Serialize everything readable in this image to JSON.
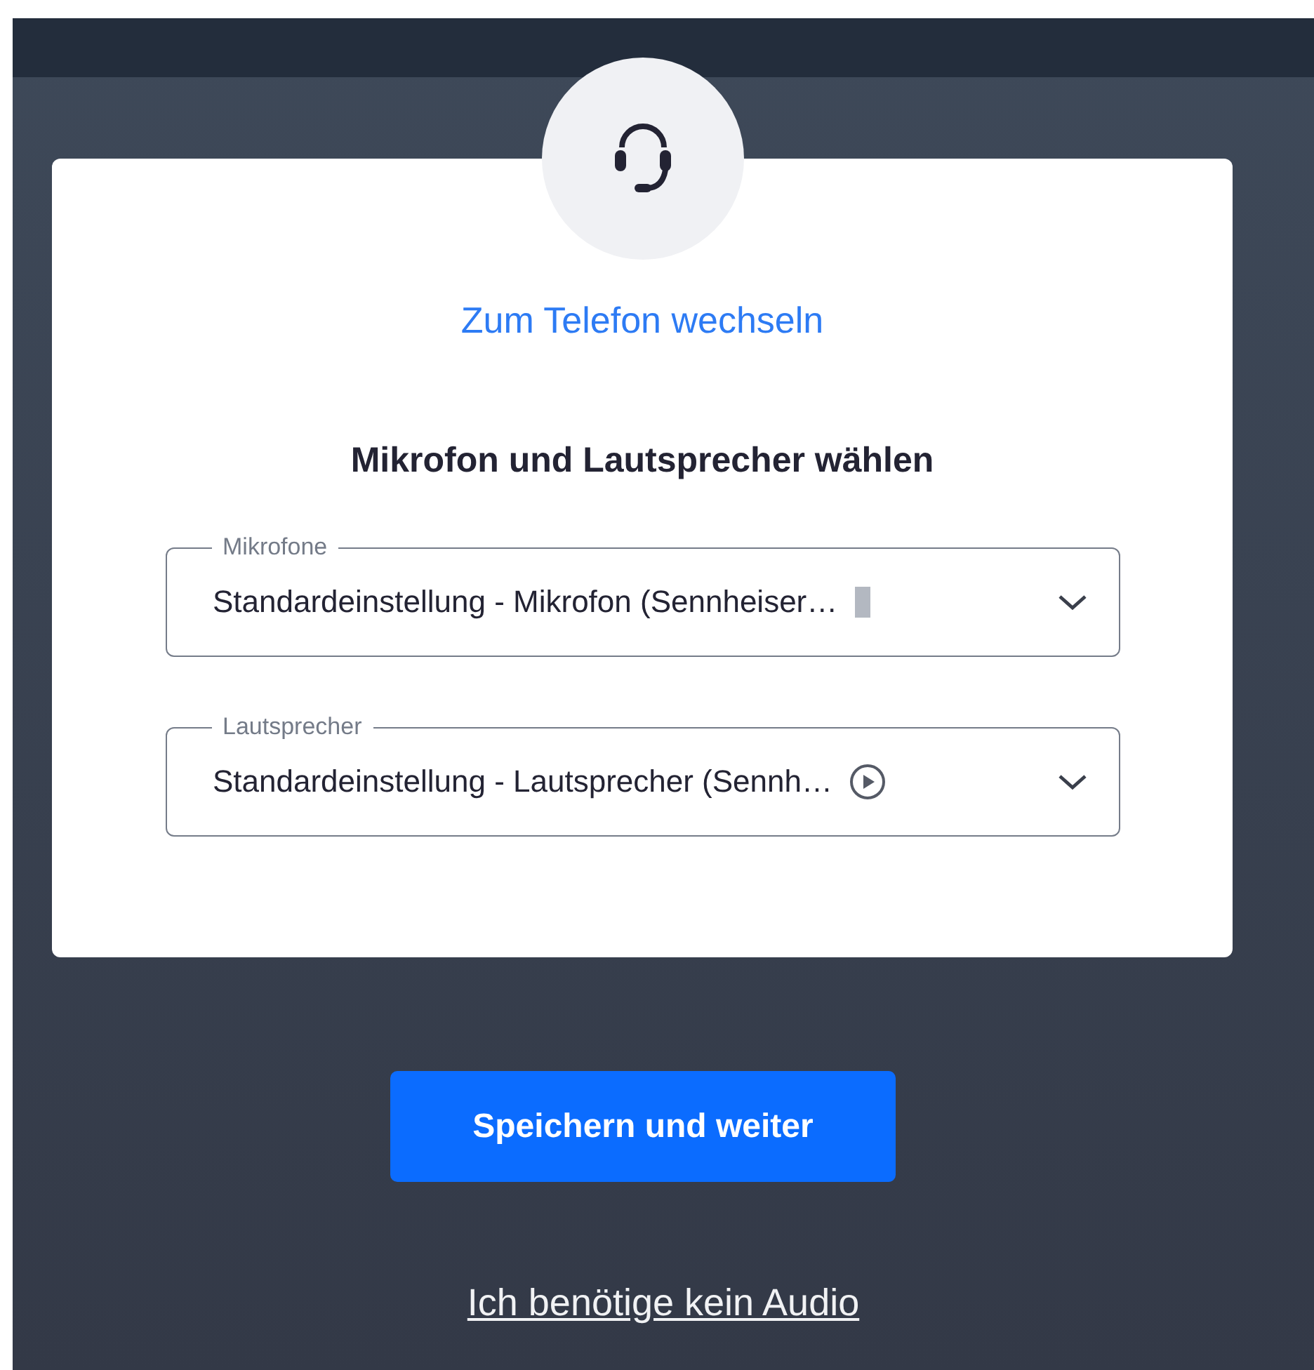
{
  "switch_link": "Zum Telefon wechseln",
  "heading": "Mikrofon und Lautsprecher wählen",
  "fields": [
    {
      "kind": "microphone",
      "label": "Mikrofone",
      "value": "Standardeinstellung - Mikrofon (Sennheiser…"
    },
    {
      "kind": "speaker",
      "label": "Lautsprecher",
      "value": "Standardeinstellung - Lautsprecher (Sennh…"
    }
  ],
  "primary_button": "Speichern und weiter",
  "skip_link": "Ich benötige kein Audio"
}
